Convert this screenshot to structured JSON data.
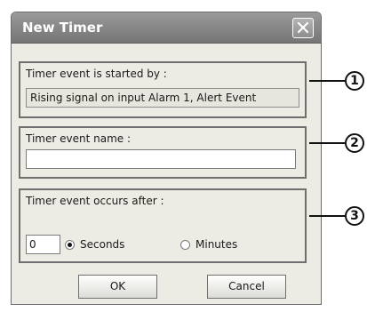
{
  "dialog": {
    "title": "New Timer",
    "close_icon": "close-icon"
  },
  "group1": {
    "label": "Timer event is started by :",
    "value": "Rising signal on input Alarm 1, Alert Event"
  },
  "group2": {
    "label": "Timer event name :",
    "value": ""
  },
  "group3": {
    "label": "Timer event occurs after :",
    "value": "0",
    "radio_seconds": "Seconds",
    "radio_minutes": "Minutes",
    "selected": "Seconds"
  },
  "buttons": {
    "ok": "OK",
    "cancel": "Cancel"
  },
  "callouts": [
    "1",
    "2",
    "3"
  ]
}
